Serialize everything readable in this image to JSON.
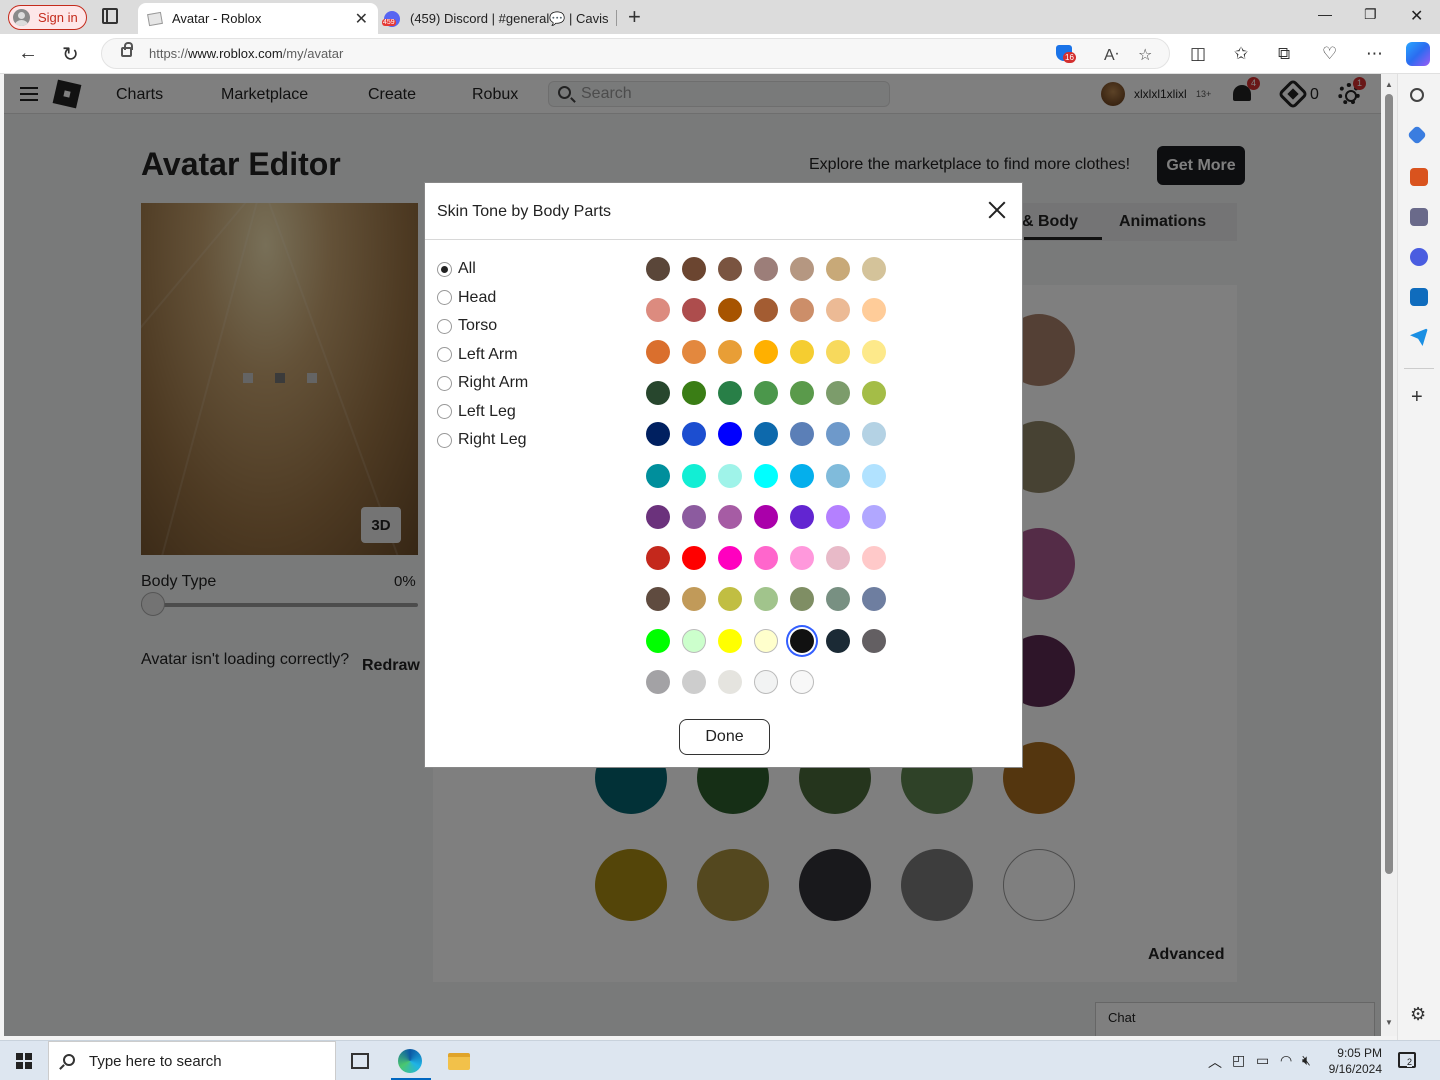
{
  "browser": {
    "signin_label": "Sign in",
    "tabs": [
      {
        "title": "Avatar - Roblox",
        "active": true
      },
      {
        "title": "(459) Discord | #general💬 | Cavis",
        "active": false
      }
    ],
    "url_prefix": "https://",
    "url_host": "www.roblox.com",
    "url_path": "/my/avatar",
    "tracker_badge": "16",
    "copilot_icon": "copilot-icon"
  },
  "site_nav": {
    "links": [
      "Charts",
      "Marketplace",
      "Create",
      "Robux"
    ],
    "search_placeholder": "Search",
    "username": "xlxlxl1xlixl",
    "age_label": "13+",
    "notifications_count": "4",
    "robux_count": "0",
    "settings_badge": "1"
  },
  "editor": {
    "title": "Avatar Editor",
    "explore_text": "Explore the marketplace to find more clothes!",
    "get_more_label": "Get More",
    "view_mode_label": "3D",
    "body_type_label": "Body Type",
    "body_type_value": "0%",
    "body_type_fraction": 0,
    "not_loading_text": "Avatar isn't loading correctly?",
    "redraw_label": "Redraw",
    "tabs": [
      "& Body",
      "Animations"
    ],
    "advanced_label": "Advanced",
    "chat_label": "Chat",
    "background_swatches": [
      "#a9806a",
      "#8f8566",
      "#a9598e",
      "#5d2b52",
      "#05636f",
      "#2c5e2c",
      "#4a6b3b",
      "#5f8450",
      "#a96c1e",
      "#a88b13",
      "#a8913e",
      "#333238",
      "#7a7a7a",
      "#ffffff"
    ]
  },
  "modal": {
    "title": "Skin Tone by Body Parts",
    "body_parts": [
      {
        "label": "All",
        "selected": true
      },
      {
        "label": "Head",
        "selected": false
      },
      {
        "label": "Torso",
        "selected": false
      },
      {
        "label": "Left Arm",
        "selected": false
      },
      {
        "label": "Right Arm",
        "selected": false
      },
      {
        "label": "Left Leg",
        "selected": false
      },
      {
        "label": "Right Leg",
        "selected": false
      }
    ],
    "tone_rows": [
      [
        "#5a4639",
        "#6b4530",
        "#7a5440",
        "#9c7e79",
        "#b59781",
        "#c8a978",
        "#d4c39a"
      ],
      [
        "#dc8b7f",
        "#ad4d4d",
        "#a75400",
        "#a35c32",
        "#cc8e69",
        "#ecba95",
        "#ffcc99"
      ],
      [
        "#da6f2d",
        "#e3883e",
        "#e89e36",
        "#ffb000",
        "#f5cd30",
        "#f7d95c",
        "#fde98a"
      ],
      [
        "#27462d",
        "#3a7d15",
        "#287f47",
        "#4b974b",
        "#5a9a4b",
        "#7c9c6b",
        "#a4bd47"
      ],
      [
        "#002060",
        "#1c4ed0",
        "#0000ff",
        "#0d69ac",
        "#5b7fb7",
        "#6e99ca",
        "#b4d2e4"
      ],
      [
        "#008f9c",
        "#12eed4",
        "#9ff3e9",
        "#00ffff",
        "#04afec",
        "#80bbdb",
        "#b1e2ff"
      ],
      [
        "#6b327c",
        "#8c5b9f",
        "#a65ca4",
        "#aa00aa",
        "#6225d1",
        "#b480ff",
        "#b1a7ff"
      ],
      [
        "#c4281c",
        "#ff0000",
        "#ff00bf",
        "#ff66cc",
        "#ff98dc",
        "#e8bac8",
        "#ffc9c9"
      ],
      [
        "#5f4b3f",
        "#c19a59",
        "#c1be42",
        "#a1c48c",
        "#7f8e64",
        "#789082",
        "#6e7ea0"
      ],
      [
        "#00ff00",
        "#ccffcc",
        "#ffff00",
        "#ffffcc",
        "#111111",
        "#1b2a35",
        "#635f62"
      ],
      [
        "#a3a2a5",
        "#cdcdcd",
        "#e5e4df",
        "#f2f3f3",
        "#f8f8f8"
      ]
    ],
    "selected_tone": "#111111",
    "done_label": "Done"
  },
  "taskbar": {
    "search_placeholder": "Type here to search",
    "time": "9:05 PM",
    "date": "9/16/2024",
    "notifications_count": "2"
  }
}
